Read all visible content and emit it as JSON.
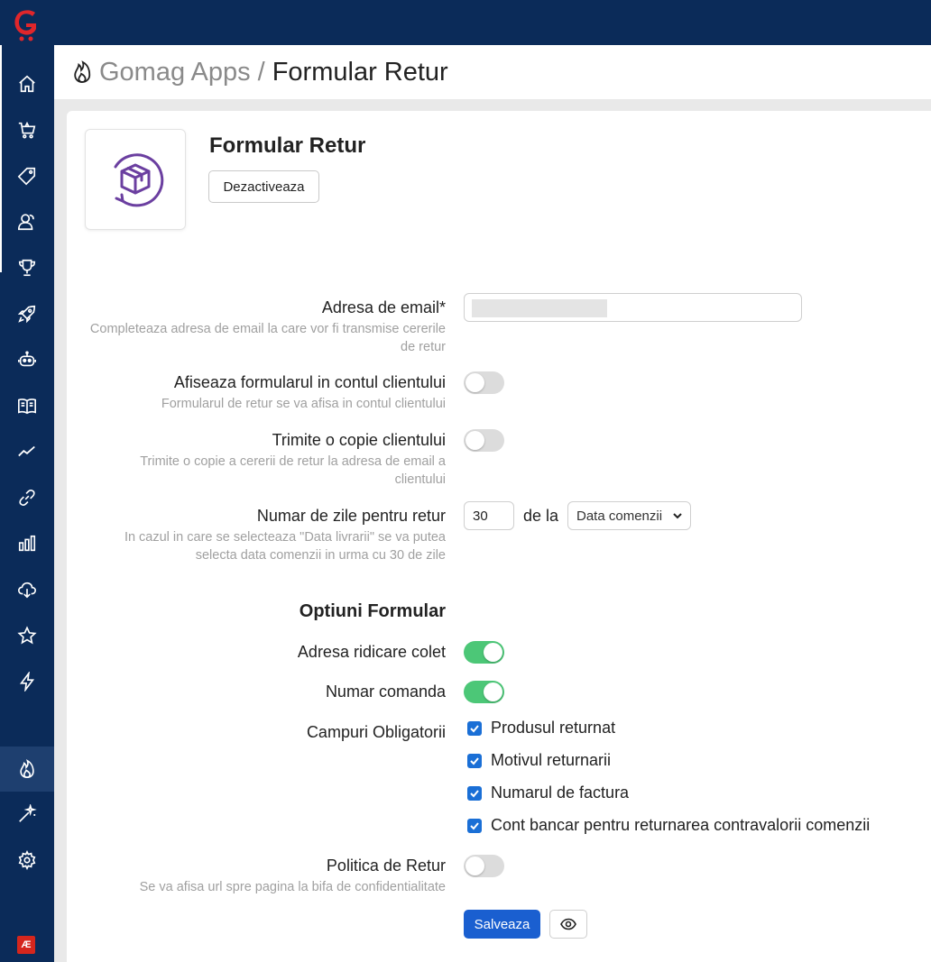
{
  "header": {
    "crumb_parent": "Gomag Apps",
    "crumb_separator": "/",
    "crumb_current": "Formular Retur"
  },
  "sidebar": {
    "items": [
      "home-icon",
      "cart-icon",
      "tag-icon",
      "customers-icon",
      "trophy-icon",
      "rocket-icon",
      "robot-icon",
      "book-icon",
      "trend-icon",
      "link-icon",
      "bar-chart-icon",
      "cloud-download-icon",
      "star-icon",
      "bolt-icon",
      "flame-icon",
      "magic-wand-icon",
      "gear-icon"
    ],
    "active": "flame-icon",
    "bottom_badge": "Æ"
  },
  "app": {
    "title": "Formular Retur",
    "deactivate_label": "Dezactiveaza"
  },
  "form": {
    "email": {
      "label": "Adresa de email*",
      "hint": "Completeaza adresa de email la care vor fi transmise cererile de retur",
      "value": ""
    },
    "show_in_account": {
      "label": "Afiseaza formularul in contul clientului",
      "hint": "Formularul de retur se va afisa in contul clientului",
      "enabled": false
    },
    "send_copy": {
      "label": "Trimite o copie clientului",
      "hint": "Trimite o copie a cererii de retur la adresa de email a clientului",
      "enabled": false
    },
    "return_days": {
      "label": "Numar de zile pentru retur",
      "hint": "In cazul in care se selecteaza \"Data livrarii\" se va putea selecta data comenzii in urma cu 30 de zile",
      "value": "30",
      "from_label": "de la",
      "from_selected": "Data comenzii"
    },
    "options_title": "Optiuni Formular",
    "pickup_address": {
      "label": "Adresa ridicare colet",
      "enabled": true
    },
    "order_number": {
      "label": "Numar comanda",
      "enabled": true
    },
    "required_fields": {
      "label": "Campuri Obligatorii",
      "items": [
        {
          "label": "Produsul returnat",
          "checked": true
        },
        {
          "label": "Motivul returnarii",
          "checked": true
        },
        {
          "label": "Numarul de factura",
          "checked": true
        },
        {
          "label": "Cont bancar pentru returnarea contravalorii comenzii",
          "checked": true
        }
      ]
    },
    "return_policy": {
      "label": "Politica de Retur",
      "hint": "Se va afisa url spre pagina la bifa de confidentialitate",
      "enabled": false
    },
    "save_label": "Salveaza"
  },
  "colors": {
    "sidebar_bg": "#0b2b59",
    "toggle_on": "#4cc777",
    "primary_button": "#1a5fd0",
    "checkbox": "#1a6fd6",
    "app_icon": "#6b3fa0"
  }
}
